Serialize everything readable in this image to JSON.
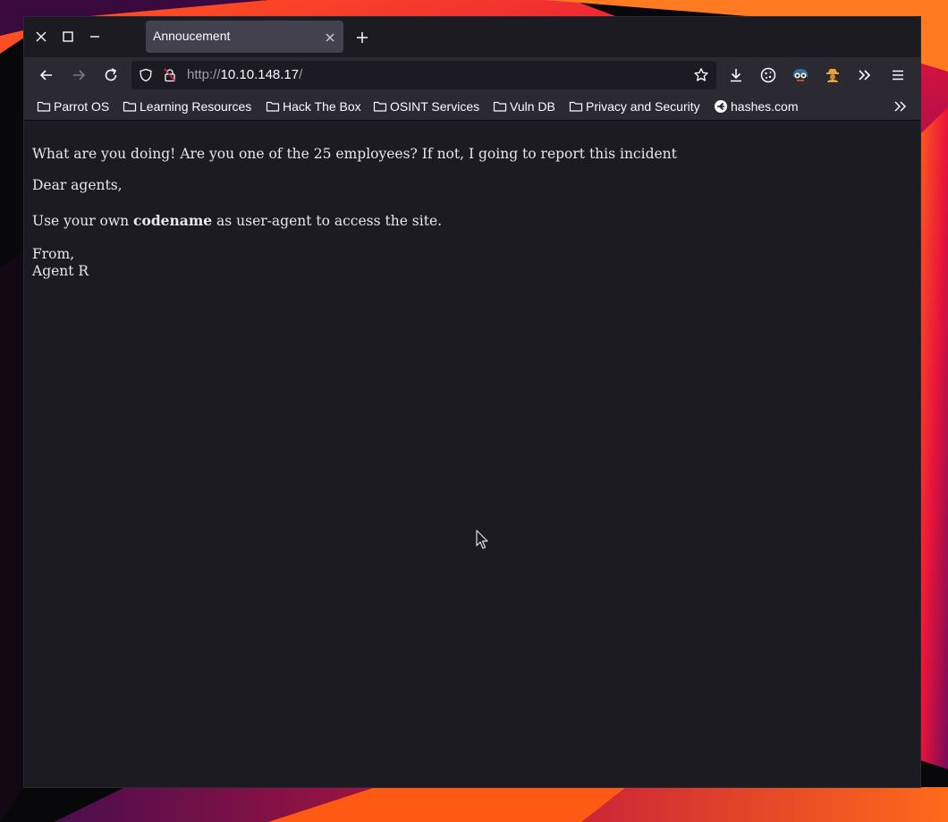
{
  "browser": {
    "tab": {
      "title": "Annoucement"
    },
    "url": {
      "scheme": "http://",
      "host": "10.10.148.17",
      "path": "/"
    },
    "bookmarks": [
      {
        "label": "Parrot OS",
        "icon": "folder-icon"
      },
      {
        "label": "Learning Resources",
        "icon": "folder-icon"
      },
      {
        "label": "Hack The Box",
        "icon": "folder-icon"
      },
      {
        "label": "OSINT Services",
        "icon": "folder-icon"
      },
      {
        "label": "Vuln DB",
        "icon": "folder-icon"
      },
      {
        "label": "Privacy and Security",
        "icon": "folder-icon"
      },
      {
        "label": "hashes.com",
        "icon": "hashes-site-icon"
      }
    ],
    "toolbar_icons": [
      "bookmark-star-icon",
      "download-icon",
      "cookie-icon",
      "foxyproxy-icon",
      "user-agent-switcher-icon",
      "extensions-overflow-icon",
      "menu-icon"
    ]
  },
  "page": {
    "warning": "What are you doing! Are you one of the 25 employees? If not, I going to report this incident",
    "greeting": "Dear agents,",
    "instruction_before": "Use your own ",
    "instruction_bold": "codename",
    "instruction_after": " as user-agent to access the site.",
    "signoff": "From,",
    "signature": "Agent R"
  },
  "colors": {
    "window_bg": "#1c1b22",
    "toolbar_bg": "#2b2a33",
    "tab_bg": "#42414d",
    "text": "#fbfbfe"
  }
}
